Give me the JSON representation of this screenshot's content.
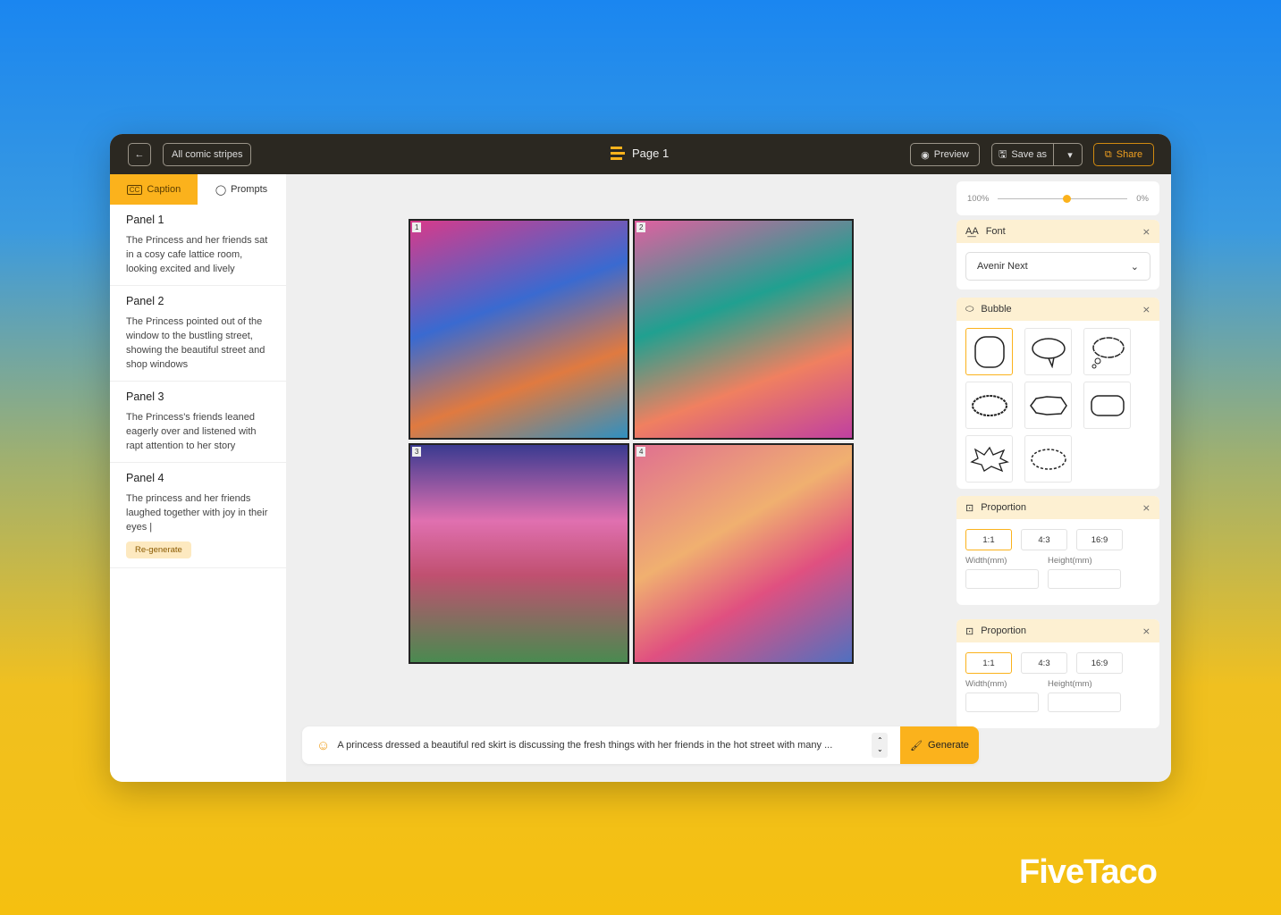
{
  "header": {
    "back_icon": "arrow-left-icon",
    "all_comics": "All comic stripes",
    "page_title": "Page 1",
    "preview": "Preview",
    "save_as": "Save as",
    "share": "Share"
  },
  "sidebar": {
    "tabs": [
      {
        "label": "Caption",
        "active": true
      },
      {
        "label": "Prompts",
        "active": false
      }
    ],
    "panels": [
      {
        "title": "Panel 1",
        "text": "The Princess and her friends sat in a cosy cafe lattice room, looking excited and lively"
      },
      {
        "title": "Panel 2",
        "text": "The Princess pointed out of the window to the bustling street, showing the beautiful street and shop windows"
      },
      {
        "title": "Panel 3",
        "text": "The Princess's friends leaned eagerly over and listened with rapt attention to her story"
      },
      {
        "title": "Panel 4",
        "text": "The princess and her friends laughed together with joy in their eyes |"
      }
    ],
    "regenerate": "Re-generate"
  },
  "canvas": {
    "panels": [
      "1",
      "2",
      "3",
      "4"
    ]
  },
  "right": {
    "slider": {
      "left": "100%",
      "right": "0%",
      "value": 0.5
    },
    "font": {
      "title": "Font",
      "value": "Avenir Next"
    },
    "bubble": {
      "title": "Bubble",
      "selected": 0
    },
    "proportion": [
      {
        "title": "Proportion",
        "ratios": [
          "1:1",
          "4:3",
          "16:9"
        ],
        "selected": "1:1",
        "width_label": "Width(mm)",
        "height_label": "Height(mm)",
        "width": "",
        "height": ""
      },
      {
        "title": "Proportion",
        "ratios": [
          "1:1",
          "4:3",
          "16:9"
        ],
        "selected": "1:1",
        "width_label": "Width(mm)",
        "height_label": "Height(mm)",
        "width": "",
        "height": ""
      }
    ]
  },
  "prompt": {
    "text": "A princess dressed a beautiful red skirt is discussing the fresh things with her friends in the hot street with many ...",
    "generate": "Generate"
  },
  "brand": "FiveTaco",
  "colors": {
    "accent": "#fbb21c",
    "header": "#2b2821"
  }
}
